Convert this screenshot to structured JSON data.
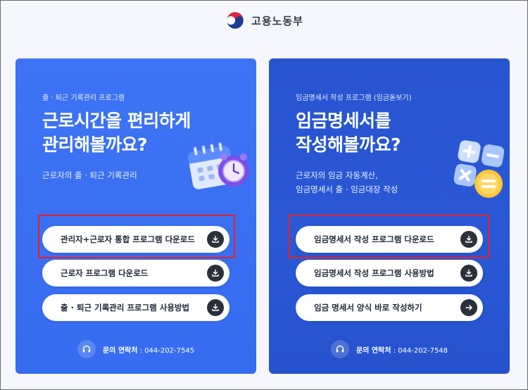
{
  "header": {
    "logo_text": "고용노동부"
  },
  "cards": [
    {
      "eyebrow": "출 · 퇴근 기록관리 프로그램",
      "title_line1": "근로시간을 편리하게",
      "title_line2": "관리해볼까요?",
      "desc_line1": "근로자의 출 · 퇴근 기록관리",
      "desc_line2": "",
      "buttons": [
        {
          "label": "관리자+근로자 통합 프로그램 다운로드",
          "icon": "download-icon"
        },
        {
          "label": "근로자 프로그램 다운로드",
          "icon": "download-icon"
        },
        {
          "label": "출 · 퇴근 기록관리 프로그램 사용방법",
          "icon": "download-icon"
        }
      ],
      "contact_label": "문의 연락처",
      "contact_sep": " : ",
      "contact_phone": "044-202-7545",
      "color": "#3d73f4"
    },
    {
      "eyebrow": "임금명세서 작성 프로그램 (임금돋보기)",
      "title_line1": "임금명세서를",
      "title_line2": "작성해볼까요?",
      "desc_line1": "근로자의 임금 자동계산,",
      "desc_line2": "임금명세서 출 · 임금대장 작성",
      "buttons": [
        {
          "label": "임금명세서 작성 프로그램 다운로드",
          "icon": "download-icon"
        },
        {
          "label": "임금명세서 작성 프로그램 사용방법",
          "icon": "download-icon"
        },
        {
          "label": "임금 명세서 양식 바로 작성하기",
          "icon": "arrow-right-icon"
        }
      ],
      "contact_label": "문의 연락처",
      "contact_sep": " : ",
      "contact_phone": "044-202-7548",
      "color": "#2754cf"
    }
  ],
  "highlight_color": "#e3222b"
}
